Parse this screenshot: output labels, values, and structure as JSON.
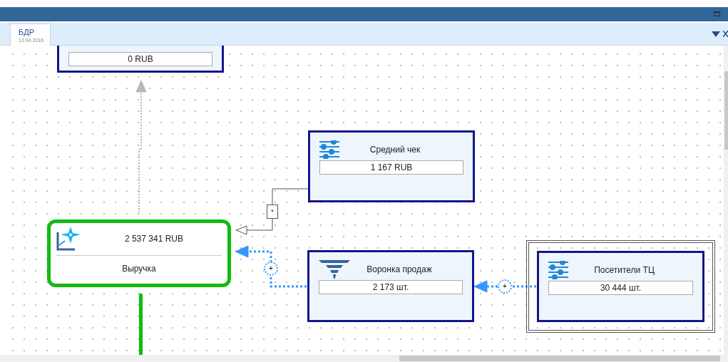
{
  "tabs": [
    {
      "label": "БДР",
      "date": "13.04.2016",
      "selected": true
    }
  ],
  "nodes": [
    {
      "kind": "input",
      "value": "0 RUB",
      "selected": false
    },
    {
      "kind": "input",
      "title": "Средний чек",
      "value": "1 167 RUB",
      "selected": false
    },
    {
      "kind": "result",
      "title": "Выручка",
      "value": "2 537 341 RUB",
      "selected": false
    },
    {
      "kind": "funnel",
      "title": "Воронка продаж",
      "value": "2 173 шт.",
      "selected": false
    },
    {
      "kind": "input",
      "title": "Посетители ТЦ",
      "value": "30 444 шт.",
      "selected": true
    }
  ],
  "connectors": [
    {
      "kind": "dotted-grey"
    },
    {
      "kind": "solid",
      "label": "*"
    },
    {
      "kind": "dotted-blue",
      "label": "+"
    },
    {
      "kind": "dotted-blue",
      "label": "+"
    }
  ]
}
